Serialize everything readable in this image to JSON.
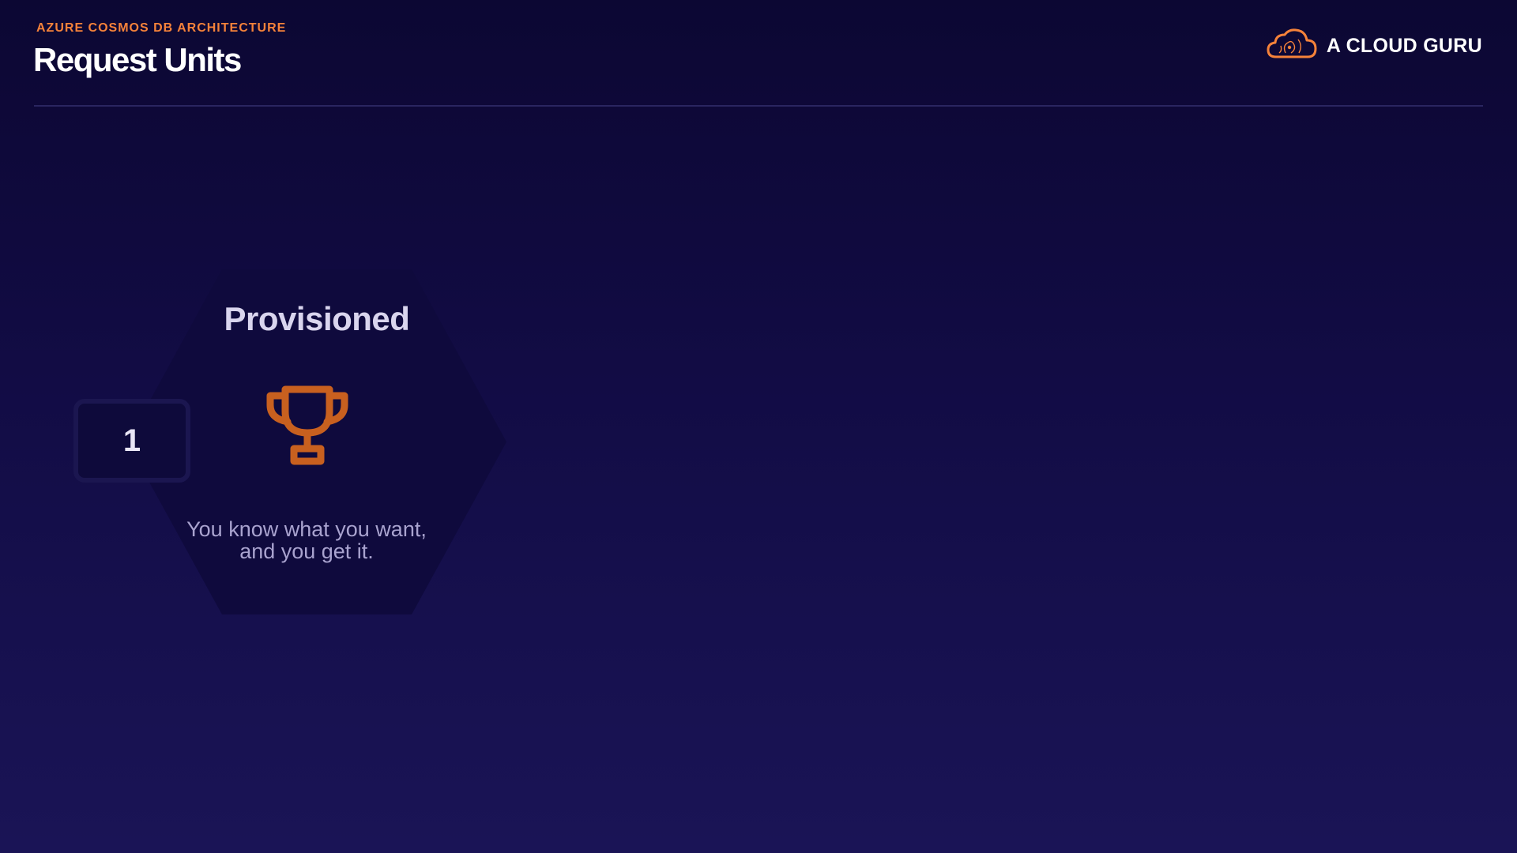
{
  "header": {
    "eyebrow": "AZURE COSMOS DB ARCHITECTURE",
    "title": "Request Units"
  },
  "brand": {
    "name": "A CLOUD GURU",
    "icon": "cloud-logo-icon",
    "accent_color": "#f5823a"
  },
  "card": {
    "number": "1",
    "title": "Provisioned",
    "icon": "trophy-icon",
    "icon_color": "#c8601f",
    "description": "You know what you want,\nand you get it."
  }
}
